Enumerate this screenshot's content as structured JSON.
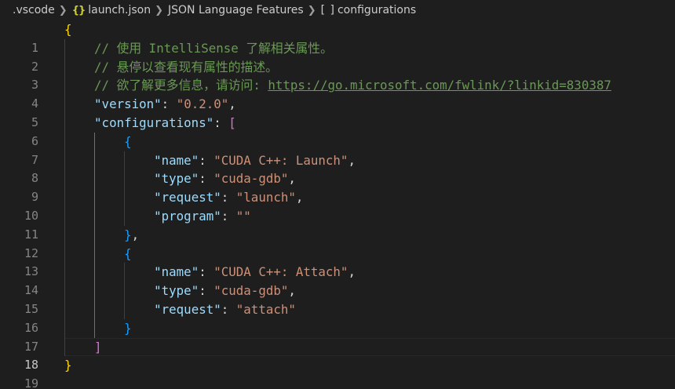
{
  "breadcrumb": {
    "folder": ".vscode",
    "file": "launch.json",
    "section": "JSON Language Features",
    "symbol": "configurations",
    "file_icon": "{}",
    "symbol_icon": "[ ]"
  },
  "editor": {
    "line_numbers": [
      "1",
      "2",
      "3",
      "4",
      "5",
      "6",
      "7",
      "8",
      "9",
      "10",
      "11",
      "12",
      "13",
      "14",
      "15",
      "16",
      "17",
      "18",
      "19"
    ],
    "current_line": "18",
    "code": {
      "open_brace": "{",
      "comment1": "// 使用 IntelliSense 了解相关属性。",
      "comment2": "// 悬停以查看现有属性的描述。",
      "comment3_prefix": "// 欲了解更多信息，请访问: ",
      "comment3_link": "https://go.microsoft.com/fwlink/?linkid=830387",
      "version_key": "\"version\"",
      "version_value": "\"0.2.0\"",
      "configurations_key": "\"configurations\"",
      "open_bracket": "[",
      "close_bracket": "]",
      "obj_open": "{",
      "obj_close": "}",
      "obj_close_comma": "},",
      "config1": {
        "name_key": "\"name\"",
        "name_value": "\"CUDA C++: Launch\"",
        "type_key": "\"type\"",
        "type_value": "\"cuda-gdb\"",
        "request_key": "\"request\"",
        "request_value": "\"launch\"",
        "program_key": "\"program\"",
        "program_value": "\"\""
      },
      "config2": {
        "name_key": "\"name\"",
        "name_value": "\"CUDA C++: Attach\"",
        "type_key": "\"type\"",
        "type_value": "\"cuda-gdb\"",
        "request_key": "\"request\"",
        "request_value": "\"attach\""
      },
      "close_brace": "}"
    }
  },
  "colors": {
    "background": "#1e1e1e",
    "key": "#9cdcfe",
    "string": "#ce9178",
    "comment": "#6a9955",
    "bracket_level1": "#ffd700",
    "bracket_level2": "#da70d6",
    "bracket_level3": "#179fff"
  }
}
